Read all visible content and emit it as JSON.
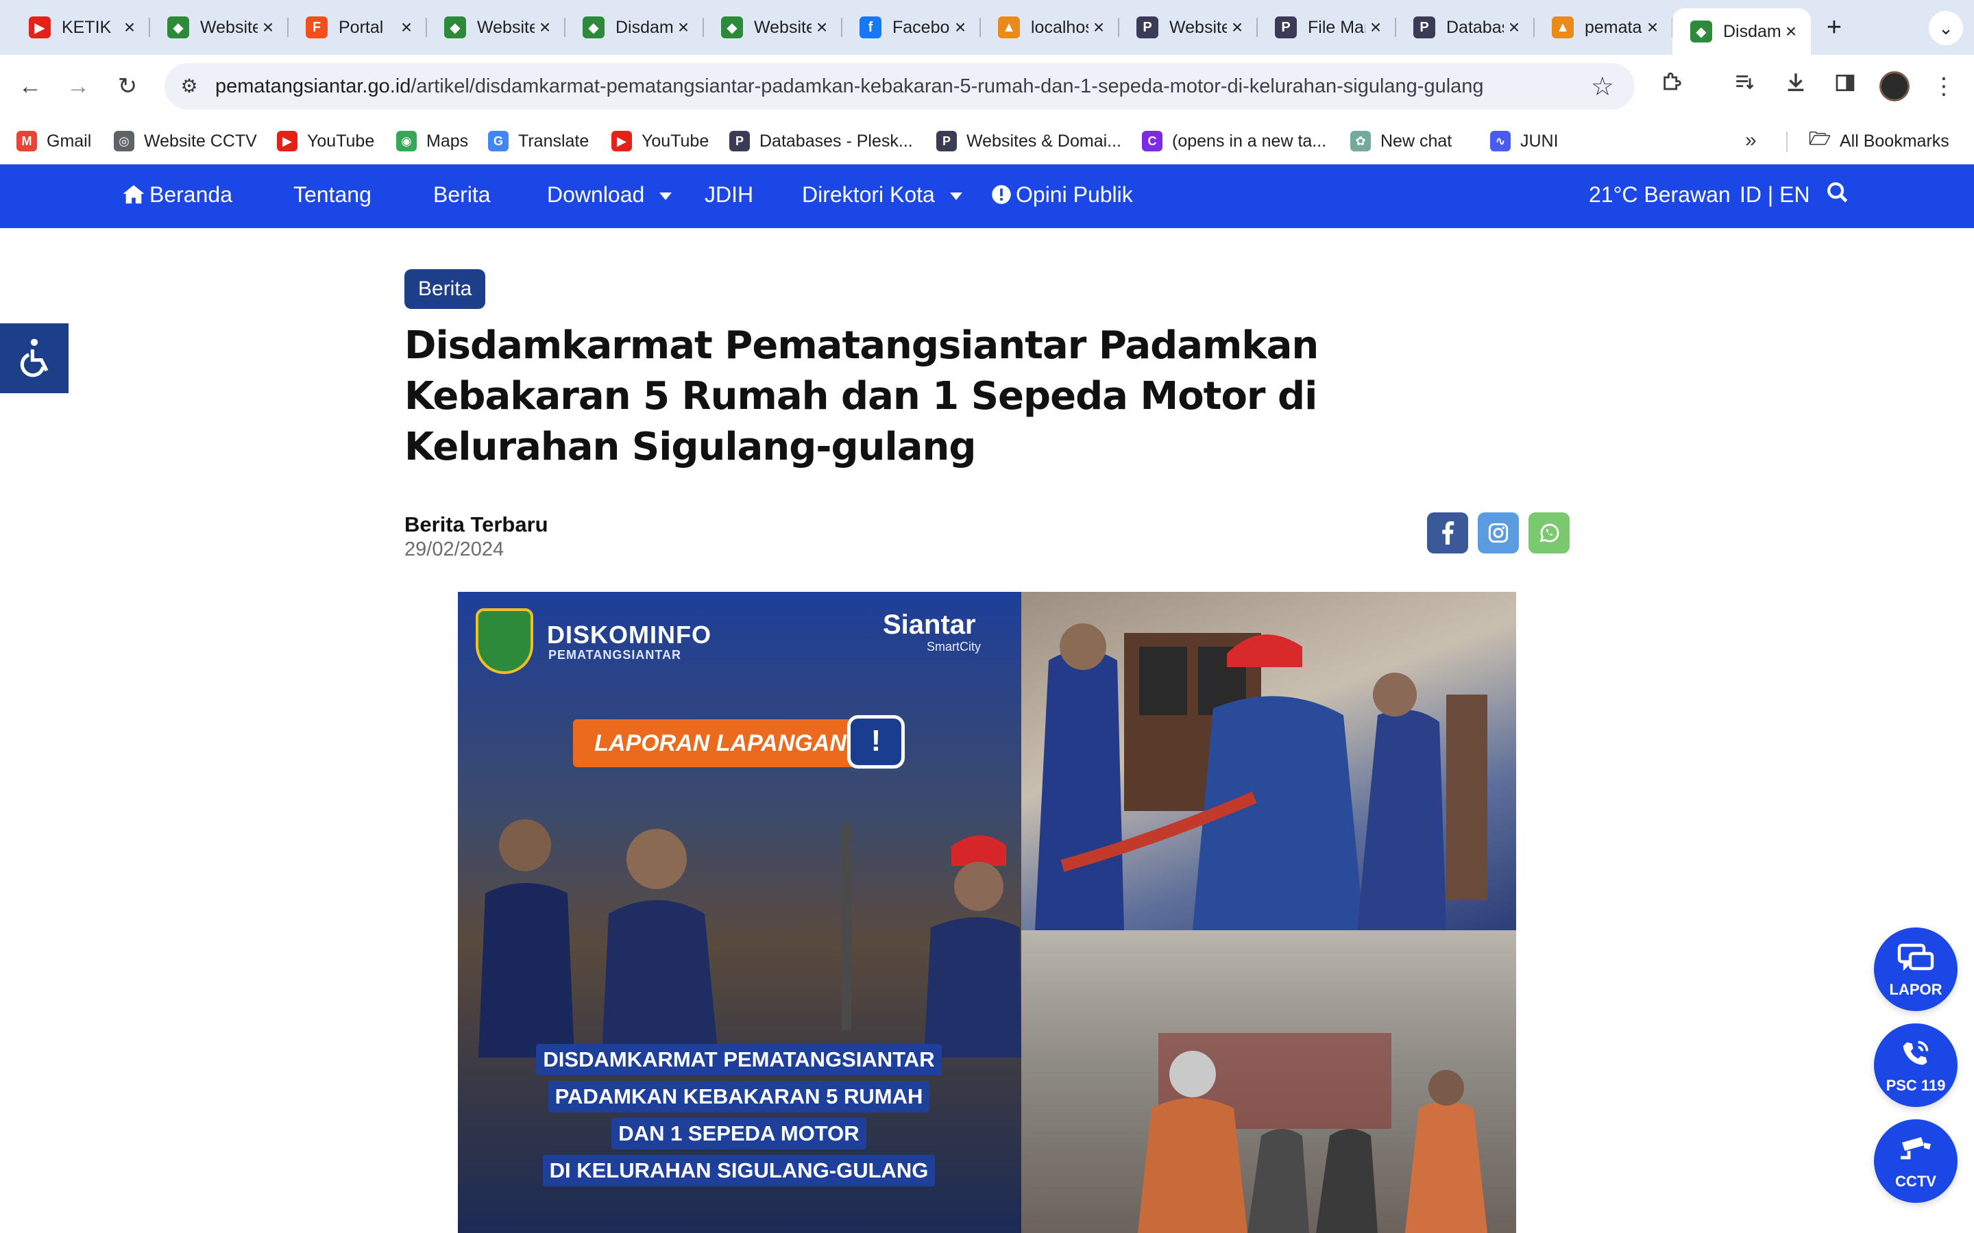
{
  "browser": {
    "tabs": [
      {
        "title": "KETIK",
        "favicon": "youtube-icon",
        "color": "#e62117"
      },
      {
        "title": "Website",
        "favicon": "pemkot-crest-icon",
        "color": "#2c8a3a"
      },
      {
        "title": "Portal",
        "favicon": "figma-icon",
        "color": "#f24e1e"
      },
      {
        "title": "Website",
        "favicon": "pemkot-crest-icon",
        "color": "#2c8a3a"
      },
      {
        "title": "Disdamkarmat",
        "favicon": "pemkot-crest-icon",
        "color": "#2c8a3a"
      },
      {
        "title": "Website",
        "favicon": "pemkot-crest-icon",
        "color": "#2c8a3a"
      },
      {
        "title": "Facebook",
        "favicon": "facebook-icon",
        "color": "#1877f2"
      },
      {
        "title": "localhost",
        "favicon": "pma-icon",
        "color": "#e88b1a"
      },
      {
        "title": "Websites",
        "favicon": "plesk-icon",
        "color": "#3b3b55"
      },
      {
        "title": "File Manager",
        "favicon": "plesk-icon",
        "color": "#3b3b55"
      },
      {
        "title": "Databases",
        "favicon": "plesk-icon",
        "color": "#3b3b55"
      },
      {
        "title": "pematangsiantar",
        "favicon": "pma-icon",
        "color": "#e88b1a"
      },
      {
        "title": "Disdamkarmat",
        "favicon": "pemkot-crest-icon",
        "color": "#2c8a3a",
        "active": true
      }
    ],
    "address": {
      "host": "pematangsiantar.go.id",
      "path": "/artikel/disdamkarmat-pematangsiantar-padamkan-kebakaran-5-rumah-dan-1-sepeda-motor-di-kelurahan-sigulang-gulang"
    },
    "bookmarks": [
      {
        "label": "Gmail",
        "icon": "gmail-icon",
        "color": "#ea4335"
      },
      {
        "label": "Website CCTV",
        "icon": "globe-icon",
        "color": "#5f6368"
      },
      {
        "label": "YouTube",
        "icon": "youtube-icon",
        "color": "#e62117"
      },
      {
        "label": "Maps",
        "icon": "maps-icon",
        "color": "#34a853"
      },
      {
        "label": "Translate",
        "icon": "translate-icon",
        "color": "#4285f4"
      },
      {
        "label": "YouTube",
        "icon": "youtube-icon",
        "color": "#e62117"
      },
      {
        "label": "Databases - Plesk...",
        "icon": "plesk-icon",
        "color": "#3b3b55"
      },
      {
        "label": "Websites & Domai...",
        "icon": "plesk-icon",
        "color": "#3b3b55"
      },
      {
        "label": "(opens in a new ta...",
        "icon": "canva-icon",
        "color": "#7d2ae8"
      },
      {
        "label": "New chat",
        "icon": "chatgpt-icon",
        "color": "#74aa9c"
      },
      {
        "label": "JUNI",
        "icon": "juni-icon",
        "color": "#4a5cf0"
      }
    ],
    "all_bookmarks": "All Bookmarks"
  },
  "site": {
    "nav": {
      "home": "Beranda",
      "about": "Tentang",
      "news": "Berita",
      "download": "Download",
      "jdih": "JDIH",
      "directory": "Direktori Kota",
      "opinion": "Opini Publik",
      "weather": "21°C Berawan",
      "lang": "ID | EN"
    },
    "article": {
      "category": "Berita",
      "title_lines": [
        "Disdamkarmat Pematangsiantar Padamkan",
        "Kebakaran 5 Rumah dan 1 Sepeda Motor di",
        "Kelurahan Sigulang-gulang"
      ],
      "author": "Berita Terbaru",
      "date": "29/02/2024",
      "share": [
        {
          "network": "facebook",
          "color": "#3b5998"
        },
        {
          "network": "instagram",
          "color": "#5b9be0"
        },
        {
          "network": "whatsapp",
          "color": "#7bc96f"
        }
      ],
      "image": {
        "brand": "DISKOMINFO",
        "brand_sub": "PEMATANGSIANTAR",
        "smart_city": "Siantar",
        "smart_city_sub": "SmartCity",
        "report_label": "LAPORAN LAPANGAN",
        "report_mark": "!",
        "headline_lines": [
          "DISDAMKARMAT PEMATANGSIANTAR",
          "PADAMKAN KEBAKARAN 5 RUMAH",
          "DAN 1 SEPEDA MOTOR",
          "DI KELURAHAN SIGULANG-GULANG"
        ]
      }
    },
    "floating": {
      "lapor": "LAPOR",
      "psc": "PSC 119",
      "cctv": "CCTV"
    },
    "accent": "#1a47e5"
  }
}
